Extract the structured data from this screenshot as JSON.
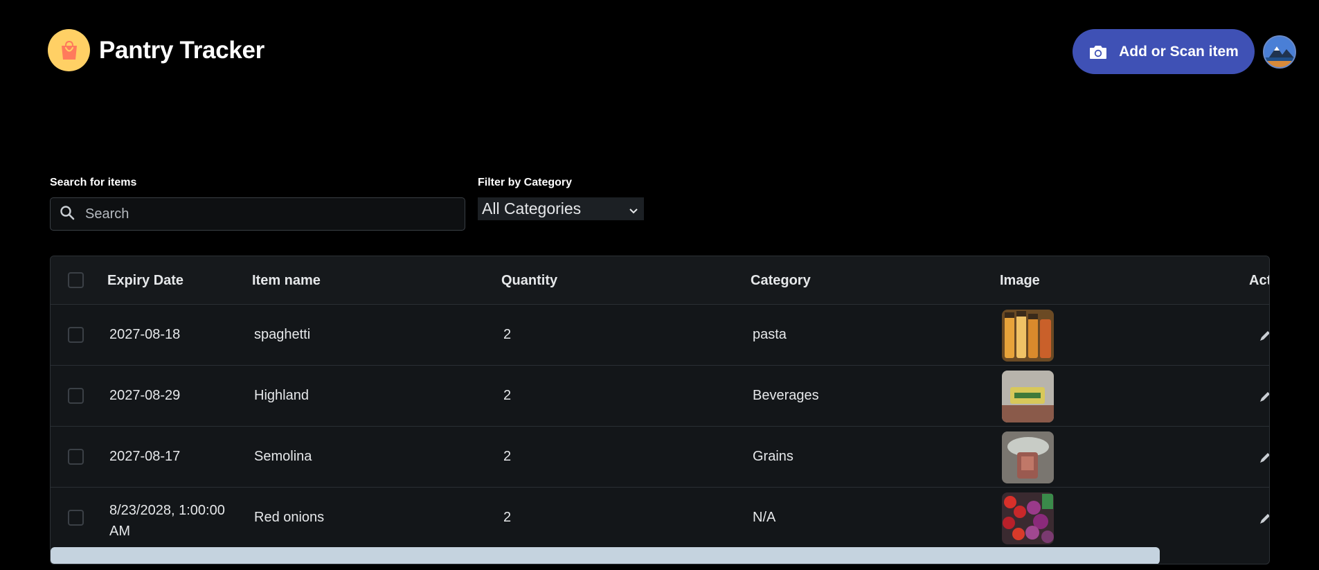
{
  "header": {
    "title": "Pantry Tracker",
    "add_button_label": "Add or Scan item",
    "logo_icon": "shopping-bag-icon",
    "add_icon": "camera-icon"
  },
  "search": {
    "label": "Search for items",
    "placeholder": "Search",
    "value": ""
  },
  "filter": {
    "label": "Filter by Category",
    "selected": "All Categories"
  },
  "table": {
    "columns": [
      "Expiry Date",
      "Item name",
      "Quantity",
      "Category",
      "Image",
      "Actions"
    ],
    "rows": [
      {
        "expiry": "2027-08-18",
        "name": "spaghetti",
        "quantity": "2",
        "category": "pasta"
      },
      {
        "expiry": "2027-08-29",
        "name": "Highland",
        "quantity": "2",
        "category": "Beverages"
      },
      {
        "expiry": "2027-08-17",
        "name": "Semolina",
        "quantity": "2",
        "category": "Grains"
      },
      {
        "expiry": "8/23/2028, 1:00:00 AM",
        "name": "Red onions",
        "quantity": "2",
        "category": "N/A"
      }
    ]
  },
  "colors": {
    "background": "#000000",
    "accent": "#3f51b5",
    "logo": "#ffd065",
    "table_bg": "#131619",
    "scrollbar": "#c5d3df"
  }
}
